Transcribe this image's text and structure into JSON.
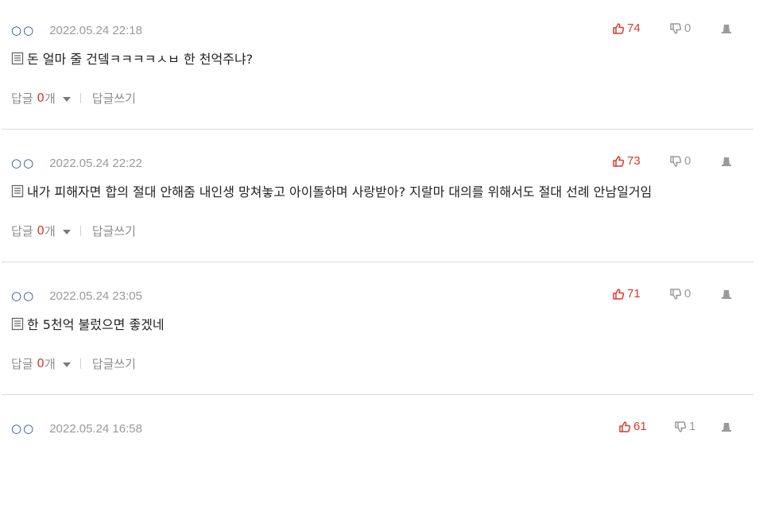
{
  "comments": [
    {
      "author": "○○",
      "date": "2022.05.24 22:18",
      "likes": "74",
      "dislikes": "0",
      "text": "돈 얼마 줄 건뎈ㅋㅋㅋㅋㅅㅂ 한 천억주냐?",
      "reply_label": "답글",
      "reply_count": "0",
      "reply_unit": "개",
      "write_reply": "답글쓰기"
    },
    {
      "author": "○○",
      "date": "2022.05.24 22:22",
      "likes": "73",
      "dislikes": "0",
      "text": "내가 피해자면 합의 절대 안해줌 내인생 망쳐놓고 아이돌하며 사랑받아? 지랄마 대의를 위해서도 절대 선례 안남일거임",
      "reply_label": "답글",
      "reply_count": "0",
      "reply_unit": "개",
      "write_reply": "답글쓰기"
    },
    {
      "author": "○○",
      "date": "2022.05.24 23:05",
      "likes": "71",
      "dislikes": "0",
      "text": "한 5천억 불렀으면 좋겠네",
      "reply_label": "답글",
      "reply_count": "0",
      "reply_unit": "개",
      "write_reply": "답글쓰기"
    },
    {
      "author": "○○",
      "date": "2022.05.24 16:58",
      "likes": "61",
      "dislikes": "1"
    }
  ],
  "colors": {
    "author": "#1f4d96",
    "like": "#d63a2e",
    "muted": "#9a9a9a",
    "separator": "#d8d8d8"
  },
  "icons": {
    "like": "thumbs-up-icon",
    "dislike": "thumbs-down-icon",
    "report": "report-icon",
    "document": "document-icon",
    "caret": "caret-down-icon"
  }
}
